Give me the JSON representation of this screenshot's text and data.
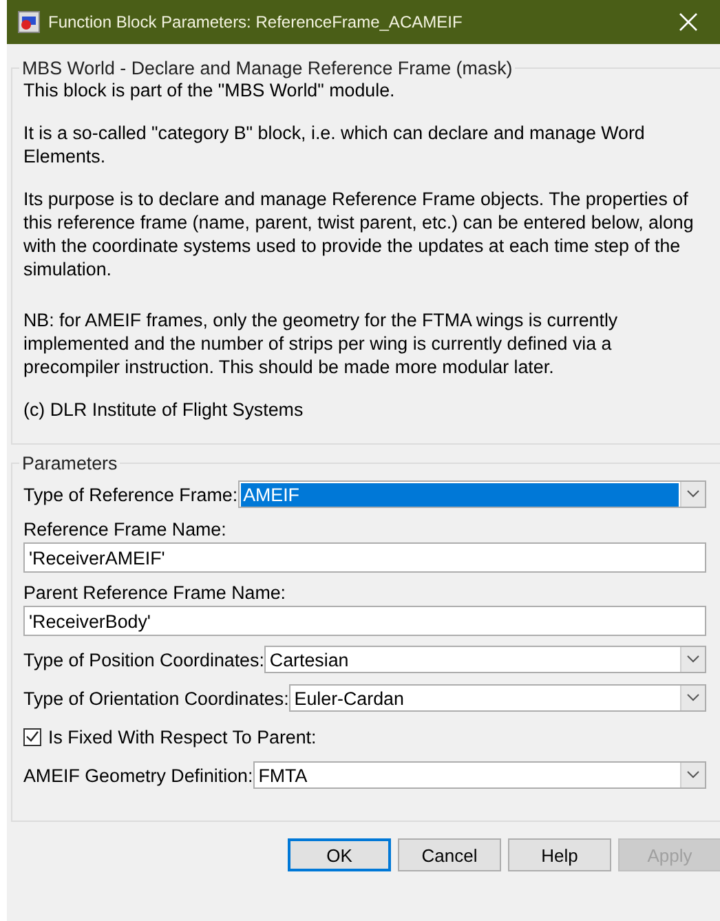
{
  "window": {
    "title": "Function Block Parameters: ReferenceFrame_ACAMEIF"
  },
  "description": {
    "title": "MBS World - Declare and Manage Reference Frame (mask)",
    "paragraphs": [
      "This block is part of the \"MBS World\" module.",
      "It is a so-called \"category B\" block, i.e. which can declare and manage Word Elements.",
      "Its purpose is to declare and manage Reference Frame objects. The properties of this reference frame (name, parent, twist parent, etc.) can be entered below, along with the coordinate systems used to provide the updates at each time step of the simulation.",
      "NB: for AMEIF frames, only the geometry for the FTMA wings is currently implemented and the number of strips per wing is currently defined via a precompiler instruction. This should be made more modular later.",
      "(c) DLR Institute of Flight Systems"
    ]
  },
  "parameters": {
    "title": "Parameters",
    "fields": [
      {
        "kind": "dropdown",
        "label": "Type of Reference Frame:",
        "value": "AMEIF",
        "focused": true
      },
      {
        "kind": "text",
        "label": "Reference Frame Name:",
        "value": "'ReceiverAMEIF'"
      },
      {
        "kind": "text",
        "label": "Parent Reference Frame Name:",
        "value": "'ReceiverBody'"
      },
      {
        "kind": "dropdown",
        "label": "Type of Position Coordinates:",
        "value": "Cartesian",
        "focused": false
      },
      {
        "kind": "dropdown",
        "label": "Type of Orientation Coordinates:",
        "value": "Euler-Cardan",
        "focused": false
      },
      {
        "kind": "checkbox",
        "label": "Is Fixed With Respect To Parent:",
        "checked": true
      },
      {
        "kind": "dropdown",
        "label": "AMEIF Geometry Definition:",
        "value": "FMTA",
        "focused": false
      }
    ]
  },
  "buttons": [
    {
      "label": "OK",
      "default": true,
      "disabled": false
    },
    {
      "label": "Cancel",
      "default": false,
      "disabled": false
    },
    {
      "label": "Help",
      "default": false,
      "disabled": false
    },
    {
      "label": "Apply",
      "default": false,
      "disabled": true
    }
  ]
}
